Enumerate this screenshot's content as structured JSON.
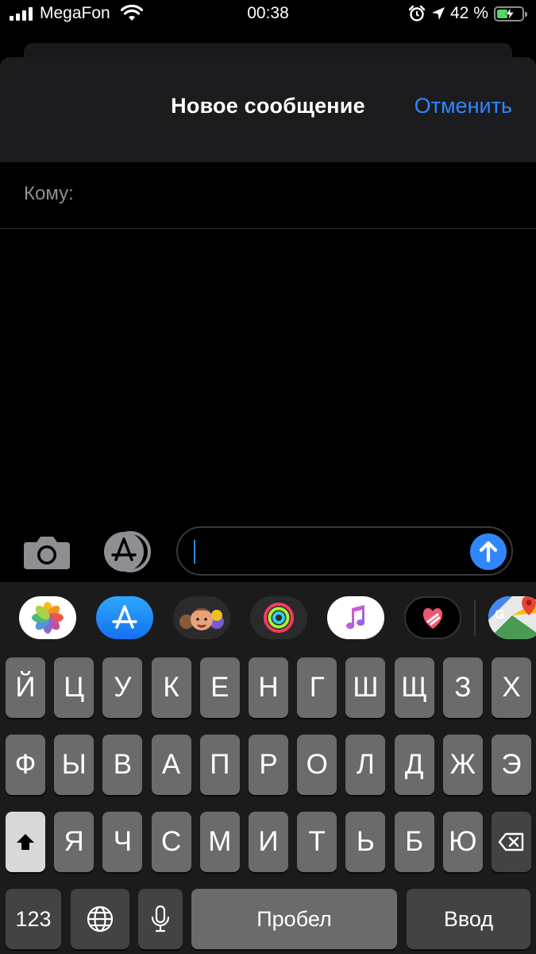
{
  "status_bar": {
    "carrier": "MegaFon",
    "time": "00:38",
    "battery_percent": "42 %",
    "battery_level": 0.42,
    "icons": [
      "signal-bars-icon",
      "wifi-icon",
      "alarm-icon",
      "location-arrow-icon",
      "battery-charging-icon"
    ]
  },
  "header": {
    "title": "Новое сообщение",
    "cancel_label": "Отменить"
  },
  "recipient": {
    "label": "Кому:",
    "value": ""
  },
  "compose": {
    "message_value": "",
    "icons": [
      "camera-icon",
      "app-store-icon",
      "send-arrow-icon"
    ]
  },
  "app_strip": [
    {
      "name": "photos",
      "icon": "photos-icon"
    },
    {
      "name": "app-store",
      "icon": "app-store-icon"
    },
    {
      "name": "memoji",
      "icon": "memoji-icon"
    },
    {
      "name": "activity",
      "icon": "activity-rings-icon"
    },
    {
      "name": "music",
      "icon": "music-note-icon"
    },
    {
      "name": "digital-touch",
      "icon": "digital-touch-heart-icon"
    },
    {
      "name": "google-maps",
      "icon": "google-maps-icon"
    }
  ],
  "keyboard": {
    "row1": [
      "Й",
      "Ц",
      "У",
      "К",
      "Е",
      "Н",
      "Г",
      "Ш",
      "Щ",
      "З",
      "Х"
    ],
    "row2": [
      "Ф",
      "Ы",
      "В",
      "А",
      "П",
      "Р",
      "О",
      "Л",
      "Д",
      "Ж",
      "Э"
    ],
    "row3": [
      "Я",
      "Ч",
      "С",
      "М",
      "И",
      "Т",
      "Ь",
      "Б",
      "Ю"
    ],
    "numbers_label": "123",
    "space_label": "Пробел",
    "return_label": "Ввод",
    "icons": [
      "shift-icon",
      "delete-icon",
      "globe-icon",
      "microphone-icon"
    ]
  },
  "colors": {
    "accent": "#2f86ff",
    "background": "#000000",
    "sheet": "#1c1c1e",
    "key": "#6b6b6b",
    "key_dark": "#434343"
  }
}
